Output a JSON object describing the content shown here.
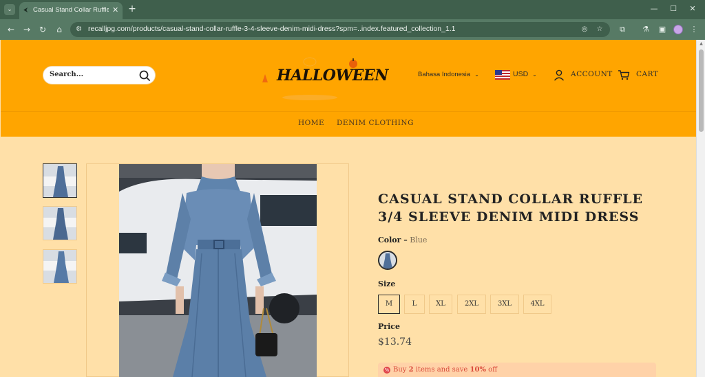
{
  "browser": {
    "tab_title": "Casual Stand Collar Ruffle 3/4 Sleeve",
    "url": "recalljpg.com/products/casual-stand-collar-ruffle-3-4-sleeve-denim-midi-dress?spm=..index.featured_collection_1.1"
  },
  "header": {
    "search_placeholder": "Search...",
    "logo_text": "HALLOWEEN",
    "language": "Bahasa Indonesia",
    "currency": "USD",
    "account": "ACCOUNT",
    "cart": "CART",
    "brand_color": "#ffa500"
  },
  "nav": {
    "items": [
      "HOME",
      "DENIM CLOTHING"
    ]
  },
  "product": {
    "title": "Casual Stand Collar Ruffle 3/4 Sleeve Denim Midi Dress",
    "color_label": "Color –",
    "color_value": "Blue",
    "size_label": "Size",
    "sizes": [
      "M",
      "L",
      "XL",
      "2XL",
      "3XL",
      "4XL"
    ],
    "selected_size": "M",
    "price_label": "Price",
    "price": "$13.74",
    "promo": {
      "prefix": "Buy ",
      "count": "2",
      "middle": " items and save ",
      "percent": "10%",
      "suffix": " off"
    }
  }
}
